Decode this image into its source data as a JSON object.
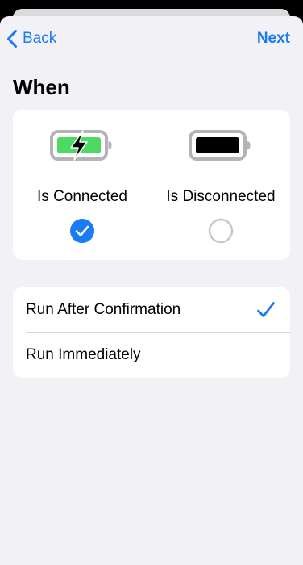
{
  "nav": {
    "back_label": "Back",
    "next_label": "Next"
  },
  "when": {
    "title": "When",
    "options": [
      {
        "label": "Is Connected",
        "icon": "battery-charging-icon",
        "selected": true
      },
      {
        "label": "Is Disconnected",
        "icon": "battery-full-icon",
        "selected": false
      }
    ]
  },
  "run_mode": {
    "options": [
      {
        "label": "Run After Confirmation",
        "selected": true
      },
      {
        "label": "Run Immediately",
        "selected": false
      }
    ]
  },
  "colors": {
    "accent": "#1a7cf5",
    "battery_green": "#4cd964",
    "background": "#f1f1f6"
  }
}
